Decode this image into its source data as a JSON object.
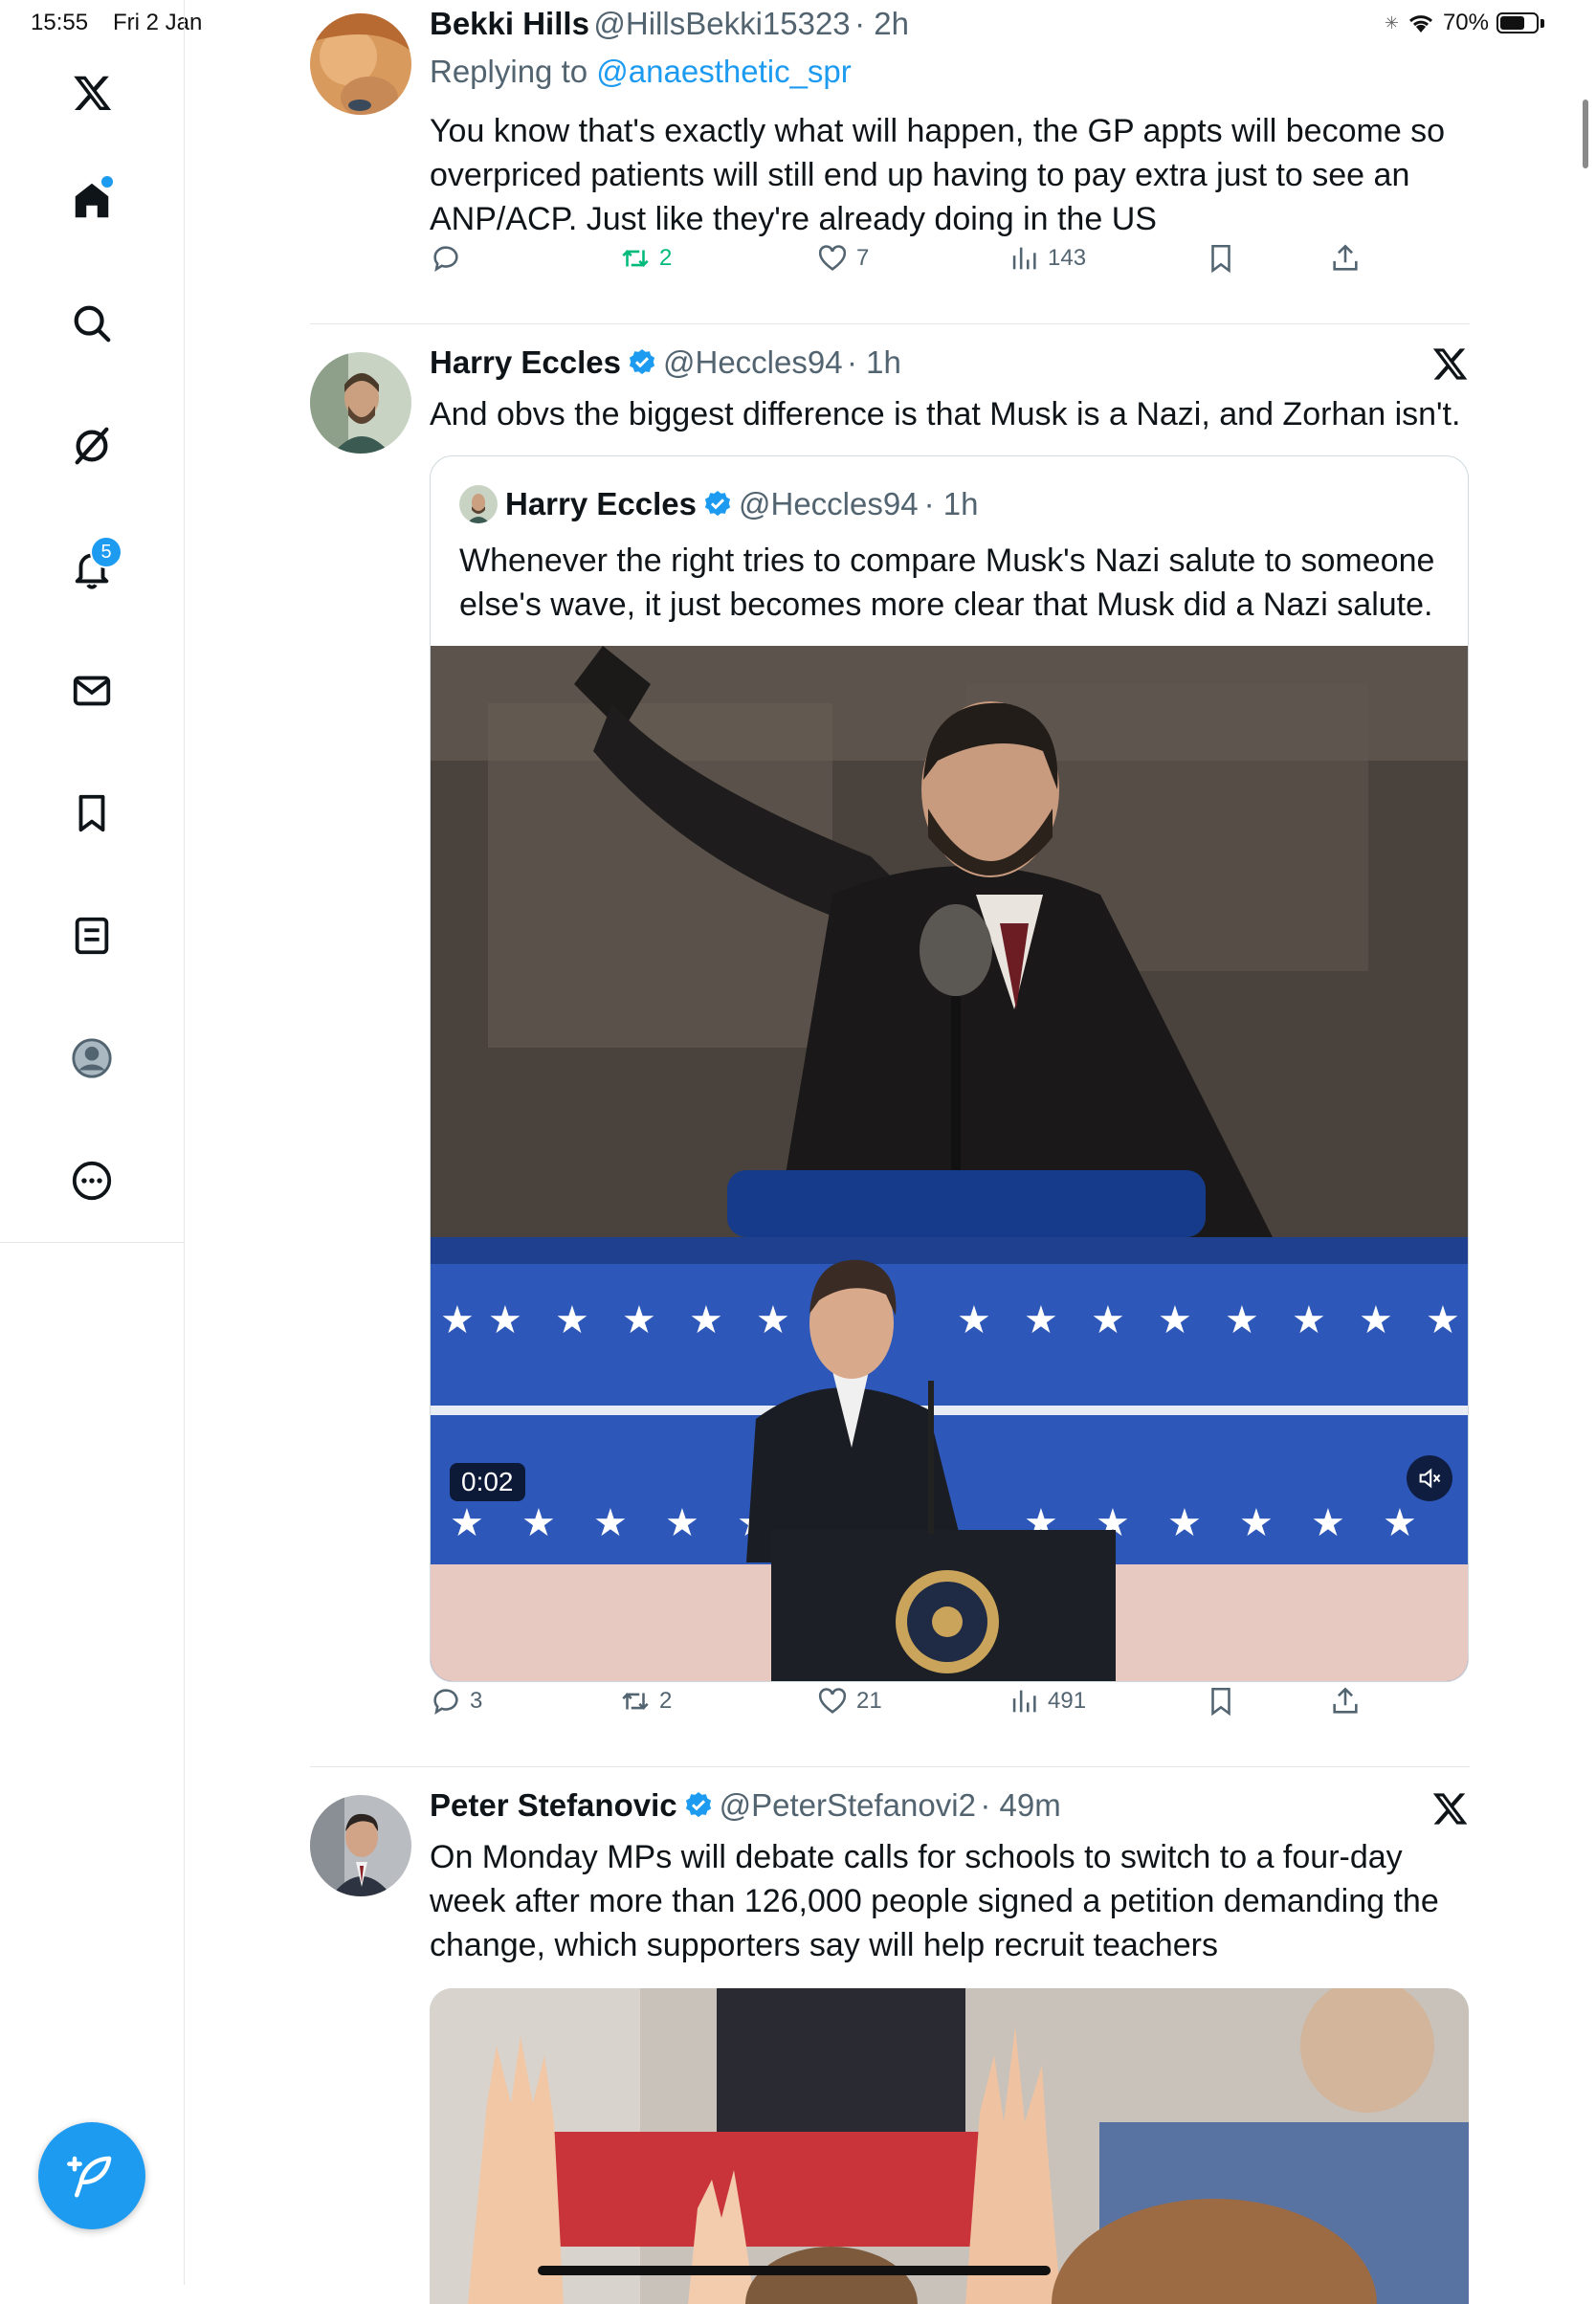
{
  "status_bar": {
    "time": "15:55",
    "date": "Fri 2 Jan",
    "battery": "70%",
    "battery_level": 0.7
  },
  "sidebar": {
    "items": [
      {
        "name": "X"
      },
      {
        "name": "Home"
      },
      {
        "name": "Search"
      },
      {
        "name": "Grok"
      },
      {
        "name": "Notifications",
        "badge": "5"
      },
      {
        "name": "Messages"
      },
      {
        "name": "Bookmarks"
      },
      {
        "name": "Lists"
      },
      {
        "name": "Profile"
      },
      {
        "name": "More"
      }
    ]
  },
  "tweets": [
    {
      "name": "Bekki Hills",
      "handle": "@HillsBekki15323",
      "time": "· 2h",
      "reply_prefix": "Replying to",
      "reply_to": "@anaesthetic_spr",
      "text": "You know that's exactly what will happen, the GP appts will become so overpriced patients will still end up having to pay extra just to see an ANP/ACP. Just like they're already doing in the US",
      "replies": "",
      "retweets": "2",
      "likes": "7",
      "views": "143"
    },
    {
      "name": "Harry Eccles",
      "handle": "@Heccles94",
      "time": "· 1h",
      "text": "And obvs the biggest difference is that Musk is a Nazi, and Zorhan isn't.",
      "quote": {
        "name": "Harry Eccles",
        "handle": "@Heccles94",
        "time": "· 1h",
        "text": "Whenever the right tries to compare Musk's Nazi salute to someone else's wave, it just becomes more clear that Musk did a Nazi salute.",
        "video_time": "0:02"
      },
      "replies": "3",
      "retweets": "2",
      "likes": "21",
      "views": "491"
    },
    {
      "name": "Peter Stefanovic",
      "handle": "@PeterStefanovi2",
      "time": "· 49m",
      "text": "On Monday MPs will debate calls for schools to switch to a four-day week after more than 126,000 people signed a petition demanding the change, which supporters say will help recruit teachers"
    }
  ],
  "colors": {
    "accent": "#1d9bf0",
    "retweet_active": "#00ba7c",
    "muted_text": "#536471"
  }
}
